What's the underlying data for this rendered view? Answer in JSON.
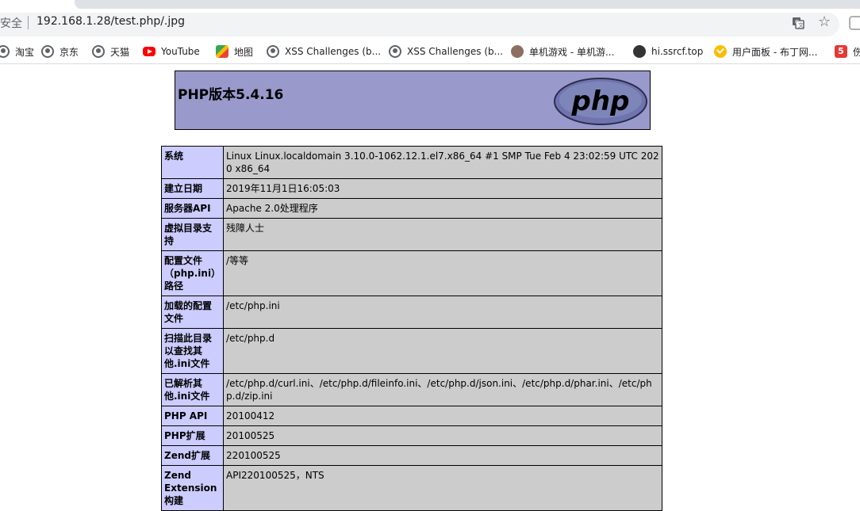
{
  "browser": {
    "security_label": "安全",
    "url": "192.168.1.28/test.php/.jpg",
    "icons": {
      "translate": "translate-icon",
      "bookmark_star": "star-icon",
      "extension": "extension-icon"
    }
  },
  "bookmarks": [
    {
      "label": "淘宝",
      "icon": "globe-icon"
    },
    {
      "label": "京东",
      "icon": "globe-icon"
    },
    {
      "label": "天猫",
      "icon": "globe-icon"
    },
    {
      "label": "YouTube",
      "icon": "youtube-icon"
    },
    {
      "label": "地图",
      "icon": "maps-icon"
    },
    {
      "label": "XSS Challenges (b...",
      "icon": "globe-icon"
    },
    {
      "label": "XSS Challenges (b...",
      "icon": "globe-icon"
    },
    {
      "label": "单机游戏 - 单机游...",
      "icon": "game-icon"
    },
    {
      "label": "hi.ssrcf.top",
      "icon": "ninja-icon"
    },
    {
      "label": "用户面板 - 布丁网...",
      "icon": "check-icon"
    },
    {
      "label": "伤",
      "icon": "five-icon",
      "icon_text": "5"
    }
  ],
  "phpinfo": {
    "title": "PHP版本5.4.16",
    "logo_text": "php",
    "rows": [
      {
        "label": "系统",
        "value": "Linux Linux.localdomain 3.10.0-1062.12.1.el7.x86_64 #1 SMP Tue Feb 4 23:02:59 UTC 2020 x86_64"
      },
      {
        "label": "建立日期",
        "value": "2019年11月1日16:05:03"
      },
      {
        "label": "服务器API",
        "value": "Apache 2.0处理程序"
      },
      {
        "label": "虚拟目录支持",
        "value": "残障人士"
      },
      {
        "label": "配置文件（php.ini）路径",
        "value": "/等等"
      },
      {
        "label": "加载的配置文件",
        "value": "/etc/php.ini"
      },
      {
        "label": "扫描此目录以查找其他.ini文件",
        "value": "/etc/php.d"
      },
      {
        "label": "已解析其他.ini文件",
        "value": "/etc/php.d/curl.ini、/etc/php.d/fileinfo.ini、/etc/php.d/json.ini、/etc/php.d/phar.ini、/etc/php.d/zip.ini"
      },
      {
        "label": "PHP API",
        "value": "20100412"
      },
      {
        "label": "PHP扩展",
        "value": "20100525"
      },
      {
        "label": "Zend扩展",
        "value": "220100525"
      },
      {
        "label": "Zend Extension 构建",
        "value": "API220100525，NTS"
      }
    ]
  }
}
